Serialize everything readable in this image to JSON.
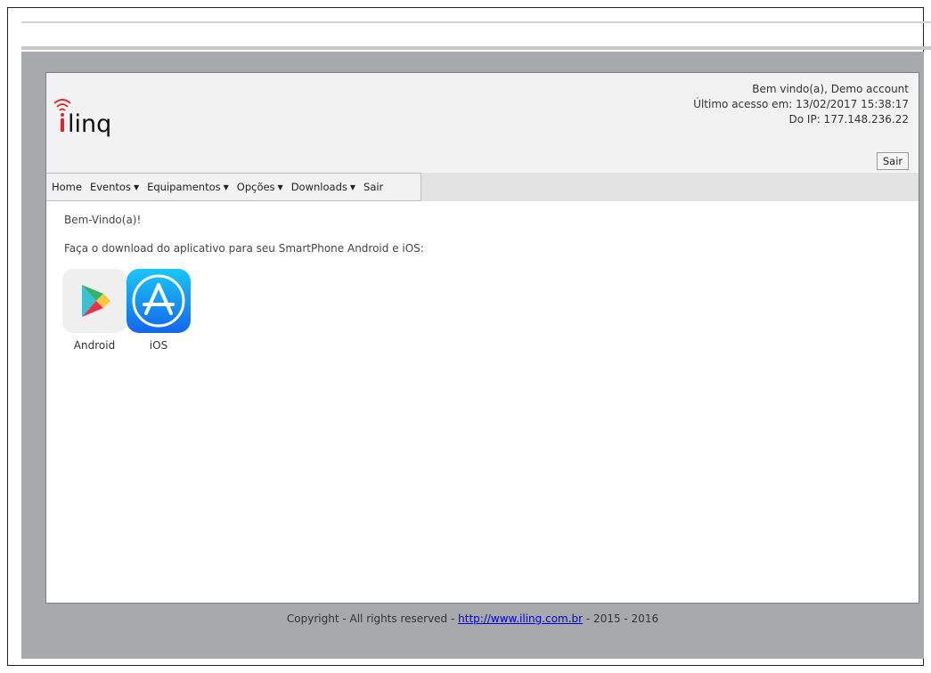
{
  "header": {
    "logo_text": "iling",
    "welcome_line": "Bem vindo(a), Demo account",
    "last_access_line": "Último acesso em: 13/02/2017 15:38:17",
    "ip_line": "Do IP: 177.148.236.22",
    "logout_label": "Sair"
  },
  "menu": {
    "items": [
      {
        "label": "Home",
        "has_dropdown": false
      },
      {
        "label": "Eventos",
        "has_dropdown": true
      },
      {
        "label": "Equipamentos",
        "has_dropdown": true
      },
      {
        "label": "Opções",
        "has_dropdown": true
      },
      {
        "label": "Downloads",
        "has_dropdown": true
      },
      {
        "label": "Sair",
        "has_dropdown": false
      }
    ],
    "caret": "▼"
  },
  "content": {
    "welcome": "Bem-Vindo(a)!",
    "download_text": "Faça o download do aplicativo para seu SmartPhone Android e iOS:",
    "apps": [
      {
        "label": "Android",
        "icon": "google-play-icon"
      },
      {
        "label": "iOS",
        "icon": "app-store-icon"
      }
    ]
  },
  "footer": {
    "prefix": "Copyright - All rights reserved - ",
    "link_text": "http://www.iling.com.br",
    "suffix": " - 2015 - 2016"
  },
  "colors": {
    "brand_red": "#e0242b",
    "background_gray": "#a7a9ad",
    "link_blue": "#0000cc",
    "ios_blue": "#1a8cf2"
  }
}
